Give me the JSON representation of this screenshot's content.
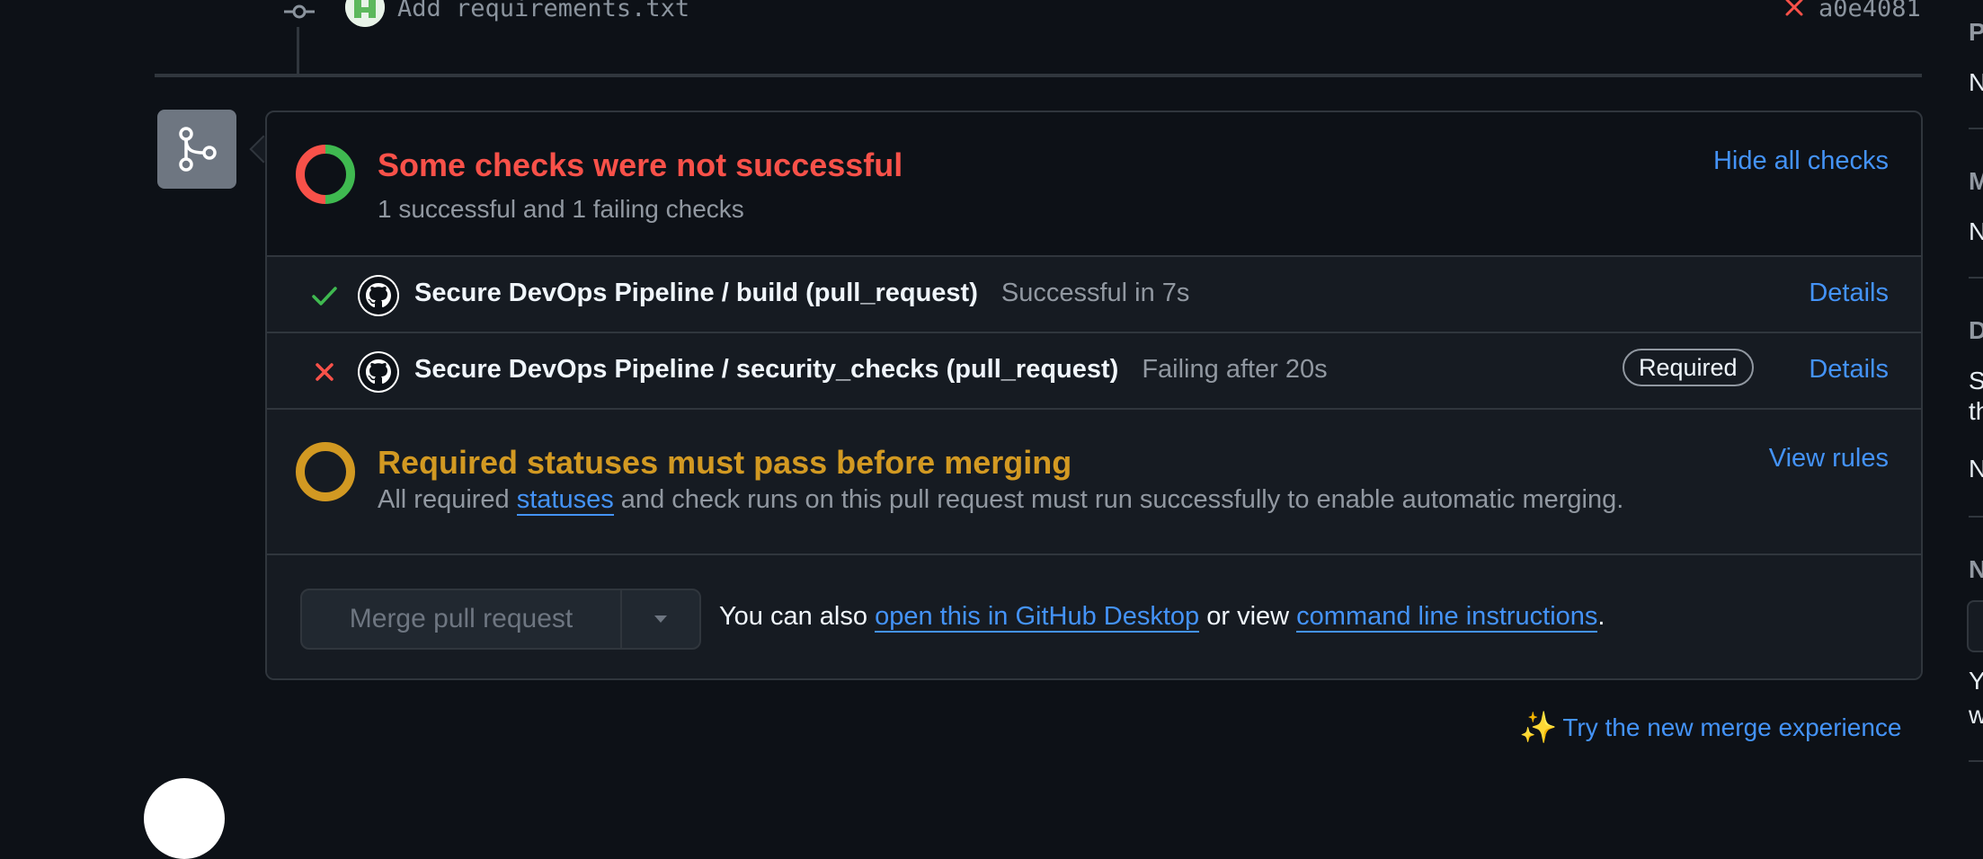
{
  "commit": {
    "message": "Add requirements.txt",
    "sha": "a0e4081",
    "status": "failed",
    "icons": {
      "node": "git-commit-icon",
      "status": "x-icon"
    }
  },
  "checks_summary": {
    "title": "Some checks were not successful",
    "subtitle": "1 successful and 1 failing checks",
    "toggle_label": "Hide all checks"
  },
  "checks": [
    {
      "name": "Secure DevOps Pipeline / build (pull_request)",
      "description": "Successful in 7s",
      "status": "success",
      "required_label": "",
      "details_label": "Details",
      "icon": "check-icon"
    },
    {
      "name": "Secure DevOps Pipeline / security_checks (pull_request)",
      "description": "Failing after 20s",
      "status": "failure",
      "required_label": "Required",
      "details_label": "Details",
      "icon": "x-icon"
    }
  ],
  "rules": {
    "title": "Required statuses must pass before merging",
    "text_before": "All required ",
    "link_text": "statuses",
    "text_after": " and check runs on this pull request must run successfully to enable automatic merging.",
    "link_label": "View rules"
  },
  "merge": {
    "button_label": "Merge pull request",
    "alt_prefix": "You can also ",
    "desktop_link": "open this in GitHub Desktop",
    "alt_middle": " or view ",
    "cli_link": "command line instructions",
    "alt_suffix": "."
  },
  "try_new": {
    "label": "Try the new merge experience",
    "icon": "sparkles-icon"
  },
  "sidebar": {
    "fragments": [
      "P",
      "N",
      "M",
      "N",
      "D",
      "S",
      "th",
      "N",
      "N",
      "Y",
      "w"
    ]
  },
  "colors": {
    "background": "#0d1117",
    "border": "#30363d",
    "danger": "#f85149",
    "success": "#3fb950",
    "attention": "#d29922",
    "accent": "#4493f8",
    "muted": "#9198a1"
  }
}
